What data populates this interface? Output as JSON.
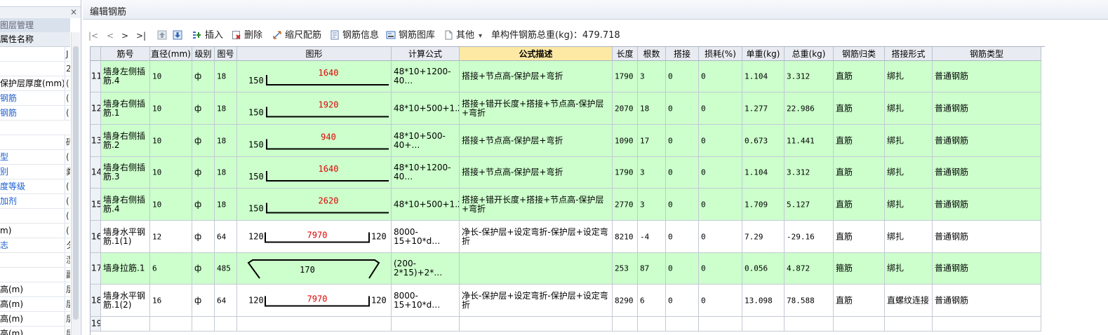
{
  "left_panel": {
    "close_glyph": "×",
    "tab_label": "图层管理",
    "header_label": "属性名称",
    "rows": [
      {
        "name": "",
        "value": "J",
        "style": "normal"
      },
      {
        "name": "",
        "value": "2",
        "style": "normal"
      },
      {
        "name": "保护层厚度(mm)",
        "value": "(",
        "style": "normal"
      },
      {
        "name": "钢筋",
        "value": "(",
        "style": "blue"
      },
      {
        "name": "钢筋",
        "value": "(",
        "style": "blue"
      },
      {
        "name": "",
        "value": "",
        "style": "normal"
      },
      {
        "name": "",
        "value": "砖",
        "style": "normal"
      },
      {
        "name": "型",
        "value": "(",
        "style": "blue"
      },
      {
        "name": "别",
        "value": "粪",
        "style": "blue"
      },
      {
        "name": "度等级",
        "value": "(",
        "style": "blue"
      },
      {
        "name": "加剂",
        "value": "(",
        "style": "blue"
      },
      {
        "name": "",
        "value": "(",
        "style": "normal"
      },
      {
        "name": "m)",
        "value": "(",
        "style": "normal"
      },
      {
        "name": "志",
        "value": "夕",
        "style": "blue"
      },
      {
        "name": "",
        "value": "湿",
        "style": "normal"
      },
      {
        "name": "",
        "value": "副",
        "style": "grey"
      },
      {
        "name": "高(m)",
        "value": "层",
        "style": "normal"
      },
      {
        "name": "高(m)",
        "value": "层",
        "style": "normal"
      },
      {
        "name": "高(m)",
        "value": "层",
        "style": "normal"
      },
      {
        "name": "高(m)",
        "value": "层",
        "style": "normal"
      }
    ]
  },
  "window": {
    "title": "编辑钢筋"
  },
  "toolbar": {
    "nav_first": "|<",
    "nav_prev": "<",
    "nav_next": ">",
    "nav_last": ">|",
    "insert": "插入",
    "delete": "删除",
    "scale_match": "缩尺配筋",
    "rebar_info": "钢筋信息",
    "rebar_library": "钢筋图库",
    "other": "其他",
    "other_caret": "▾",
    "total_weight": "单构件钢筋总重(kg)：479.718"
  },
  "grid": {
    "headers": [
      "",
      "筋号",
      "直径(mm)",
      "级别",
      "图号",
      "图形",
      "计算公式",
      "公式描述",
      "长度",
      "根数",
      "搭接",
      "损耗(%)",
      "单重(kg)",
      "总重(kg)",
      "钢筋归类",
      "搭接形式",
      "钢筋类型"
    ],
    "selected_header_index": 7,
    "rows": [
      {
        "num": "11",
        "name": "墙身左侧插筋.4",
        "dia": "10",
        "grade": "ф",
        "fig": "18",
        "shape": "hook_right",
        "s_left": "150",
        "s_mid": "1640",
        "s_right": "",
        "formula": "48*10+1200-40…",
        "desc": "搭接+节点高-保护层+弯折",
        "len": "1790",
        "count": "3",
        "lap": "0",
        "loss": "0",
        "unit_w": "1.104",
        "total_w": "3.312",
        "cat": "直筋",
        "lap_form": "绑扎",
        "type": "普通钢筋",
        "bg": "green"
      },
      {
        "num": "12",
        "name": "墙身右侧插筋.1",
        "dia": "10",
        "grade": "ф",
        "fig": "18",
        "shape": "hook_right",
        "s_left": "150",
        "s_mid": "1920",
        "s_right": "",
        "formula": "48*10+500+1.2…",
        "desc": "搭接+错开长度+搭接+节点高-保护层+弯折",
        "len": "2070",
        "count": "18",
        "lap": "0",
        "loss": "0",
        "unit_w": "1.277",
        "total_w": "22.986",
        "cat": "直筋",
        "lap_form": "绑扎",
        "type": "普通钢筋",
        "bg": "green"
      },
      {
        "num": "13",
        "name": "墙身右侧插筋.2",
        "dia": "10",
        "grade": "ф",
        "fig": "18",
        "shape": "hook_right",
        "s_left": "150",
        "s_mid": "940",
        "s_right": "",
        "formula": "48*10+500-40+…",
        "desc": "搭接+节点高-保护层+弯折",
        "len": "1090",
        "count": "17",
        "lap": "0",
        "loss": "0",
        "unit_w": "0.673",
        "total_w": "11.441",
        "cat": "直筋",
        "lap_form": "绑扎",
        "type": "普通钢筋",
        "bg": "green"
      },
      {
        "num": "14",
        "name": "墙身右侧插筋.3",
        "dia": "10",
        "grade": "ф",
        "fig": "18",
        "shape": "hook_right",
        "s_left": "150",
        "s_mid": "1640",
        "s_right": "",
        "formula": "48*10+1200-40…",
        "desc": "搭接+节点高-保护层+弯折",
        "len": "1790",
        "count": "3",
        "lap": "0",
        "loss": "0",
        "unit_w": "1.104",
        "total_w": "3.312",
        "cat": "直筋",
        "lap_form": "绑扎",
        "type": "普通钢筋",
        "bg": "green"
      },
      {
        "num": "15",
        "name": "墙身右侧插筋.4",
        "dia": "10",
        "grade": "ф",
        "fig": "18",
        "shape": "hook_right",
        "s_left": "150",
        "s_mid": "2620",
        "s_right": "",
        "formula": "48*10+500+1.2…",
        "desc": "搭接+错开长度+搭接+节点高-保护层+弯折",
        "len": "2770",
        "count": "3",
        "lap": "0",
        "loss": "0",
        "unit_w": "1.709",
        "total_w": "5.127",
        "cat": "直筋",
        "lap_form": "绑扎",
        "type": "普通钢筋",
        "bg": "green"
      },
      {
        "num": "16",
        "name": "墙身水平钢筋.1(1)",
        "dia": "12",
        "grade": "ф",
        "fig": "64",
        "shape": "hook_both",
        "s_left": "120",
        "s_mid": "7970",
        "s_right": "120",
        "formula": "8000-15+10*d…",
        "desc": "净长-保护层+设定弯折-保护层+设定弯折",
        "len": "8210",
        "count": "-4",
        "lap": "0",
        "loss": "0",
        "unit_w": "7.29",
        "total_w": "-29.16",
        "cat": "直筋",
        "lap_form": "绑扎",
        "type": "普通钢筋",
        "bg": "white"
      },
      {
        "num": "17",
        "name": "墙身拉筋.1",
        "dia": "6",
        "grade": "ф",
        "fig": "485",
        "shape": "tie",
        "s_left": "",
        "s_mid": "170",
        "s_right": "",
        "formula": "(200-2*15)+2*…",
        "desc": "",
        "len": "253",
        "count": "87",
        "lap": "0",
        "loss": "0",
        "unit_w": "0.056",
        "total_w": "4.872",
        "cat": "箍筋",
        "lap_form": "绑扎",
        "type": "普通钢筋",
        "bg": "green"
      },
      {
        "num": "18",
        "name": "墙身水平钢筋.1(2)",
        "dia": "16",
        "grade": "ф",
        "fig": "64",
        "shape": "hook_both",
        "s_left": "120",
        "s_mid": "7970",
        "s_right": "120",
        "formula": "8000-15+10*d…",
        "desc": "净长-保护层+设定弯折-保护层+设定弯折",
        "len": "8290",
        "count": "6",
        "lap": "0",
        "loss": "0",
        "unit_w": "13.098",
        "total_w": "78.588",
        "cat": "直筋",
        "lap_form": "直螺纹连接",
        "type": "普通钢筋",
        "bg": "white"
      },
      {
        "num": "19",
        "name": "",
        "dia": "",
        "grade": "",
        "fig": "",
        "shape": "",
        "s_left": "",
        "s_mid": "",
        "s_right": "",
        "formula": "",
        "desc": "",
        "len": "",
        "count": "",
        "lap": "",
        "loss": "",
        "unit_w": "",
        "total_w": "",
        "cat": "",
        "lap_form": "",
        "type": "",
        "bg": "white"
      }
    ]
  },
  "colors": {
    "row_green": "#ccffcc",
    "header_selected": "#fde9a3",
    "shape_red": "#e00000",
    "link_blue": "#1c5fd0"
  }
}
